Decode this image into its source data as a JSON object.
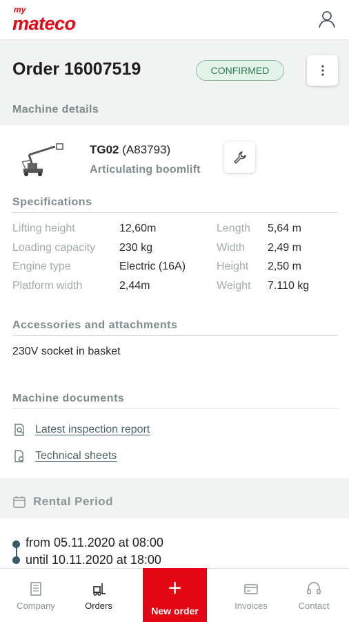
{
  "header": {
    "logo_my": "my",
    "logo_name": "mateco"
  },
  "order": {
    "title": "Order 16007519",
    "status": "CONFIRMED"
  },
  "sections": {
    "machine_details": "Machine details",
    "specifications": "Specifications",
    "accessories": "Accessories and attachments",
    "documents": "Machine documents",
    "rental_period": "Rental Period"
  },
  "machine": {
    "code": "TG02",
    "serial": "(A83793)",
    "type": "Articulating boomlift"
  },
  "specs": [
    {
      "label": "Lifting height",
      "value": "12,60m"
    },
    {
      "label": "Loading capacity",
      "value": "230 kg"
    },
    {
      "label": "Engine type",
      "value": "Electric (16A)"
    },
    {
      "label": "Platform width",
      "value": "2,44m"
    },
    {
      "label": "Length",
      "value": "5,64 m"
    },
    {
      "label": "Width",
      "value": "2,49 m"
    },
    {
      "label": "Height",
      "value": "2,50 m"
    },
    {
      "label": "Weight",
      "value": "7.110 kg"
    }
  ],
  "accessories": [
    "230V socket in basket"
  ],
  "documents": [
    {
      "label": "Latest inspection report",
      "icon": "inspection-report-icon"
    },
    {
      "label": "Technical sheets",
      "icon": "technical-sheet-icon"
    }
  ],
  "rental": {
    "from_prefix": "from",
    "from_date": "05.11.2020",
    "from_at": "at",
    "from_time": "08:00",
    "until_prefix": "until",
    "until_date": "10.11.2020",
    "until_at": "at",
    "until_time": "18:00"
  },
  "nav": {
    "company": "Company",
    "orders": "Orders",
    "new_order": "New order",
    "invoices": "Invoices",
    "contact": "Contact"
  },
  "colors": {
    "brand_red": "#e30613",
    "confirmed_green": "#2b7a4d",
    "muted_label": "#7d8b8b"
  }
}
